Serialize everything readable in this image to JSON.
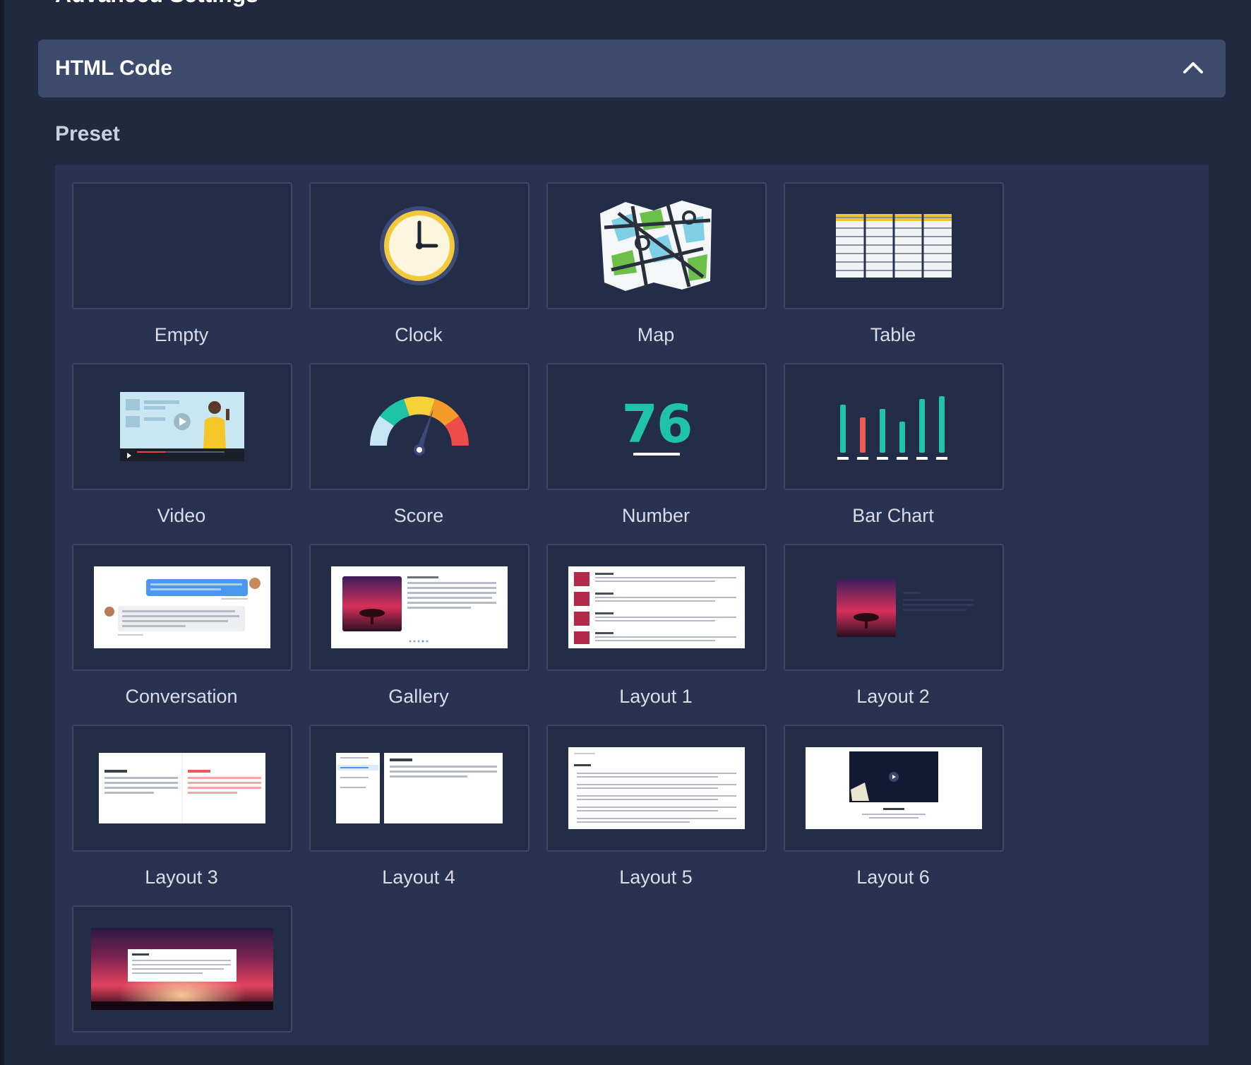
{
  "advanced": {
    "title": "Advanced Settings"
  },
  "html_section": {
    "title": "HTML Code"
  },
  "preset": {
    "label": "Preset",
    "number_value": "76",
    "presets": [
      {
        "label": "Empty"
      },
      {
        "label": "Clock"
      },
      {
        "label": "Map"
      },
      {
        "label": "Table"
      },
      {
        "label": "Video"
      },
      {
        "label": "Score"
      },
      {
        "label": "Number"
      },
      {
        "label": "Bar Chart"
      },
      {
        "label": "Conversation"
      },
      {
        "label": "Gallery"
      },
      {
        "label": "Layout 1"
      },
      {
        "label": "Layout 2"
      },
      {
        "label": "Layout 3"
      },
      {
        "label": "Layout 4"
      },
      {
        "label": "Layout 5"
      },
      {
        "label": "Layout 6"
      },
      {
        "label": ""
      }
    ]
  },
  "colors": {
    "background": "#21293e",
    "header_bar": "#3c4b6c",
    "panel": "#283352",
    "tile_border": "#3e4862",
    "teal": "#1fc4a8",
    "red": "#ee5a5a"
  }
}
